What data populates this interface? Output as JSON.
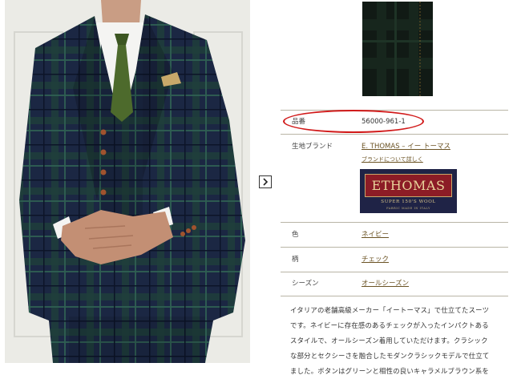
{
  "nav": {
    "next_icon": "chevron-right-icon"
  },
  "product": {
    "rows": [
      {
        "label": "品番",
        "value": "56000-961-1",
        "link": false
      },
      {
        "label": "生地ブランド",
        "value": "E. THOMAS – イー トーマス",
        "link": true,
        "sublink": "ブランドについて詳しく"
      },
      {
        "label": "色",
        "value": "ネイビー",
        "link": true
      },
      {
        "label": "柄",
        "value": "チェック",
        "link": true
      },
      {
        "label": "シーズン",
        "value": "オールシーズン",
        "link": true
      }
    ],
    "brand_logo": {
      "wordmark": "ETHOMAS",
      "subtitle": "SUPER 150'S WOOL",
      "tagline": "FABRIC MADE IN ITALY"
    },
    "description_lines": [
      "イタリアの老舗高級メーカー「イートーマス」で仕立てたスーツ",
      "です。ネイビーに存在感のあるチェックが入ったインパクトある",
      "スタイルで、オールシーズン着用していただけます。クラシック",
      "な部分とセクシーさを融合したモダンクラシックモデルで仕立て",
      "ました。ボタンはグリーンと相性の良いキャラメルブラウン系を"
    ]
  },
  "colors": {
    "accent_link": "#6b5324",
    "highlight_oval": "#d11a1a",
    "divider": "#b9b5a6",
    "suit_navy": "#1b2743",
    "tie_green": "#4d6a2c"
  }
}
